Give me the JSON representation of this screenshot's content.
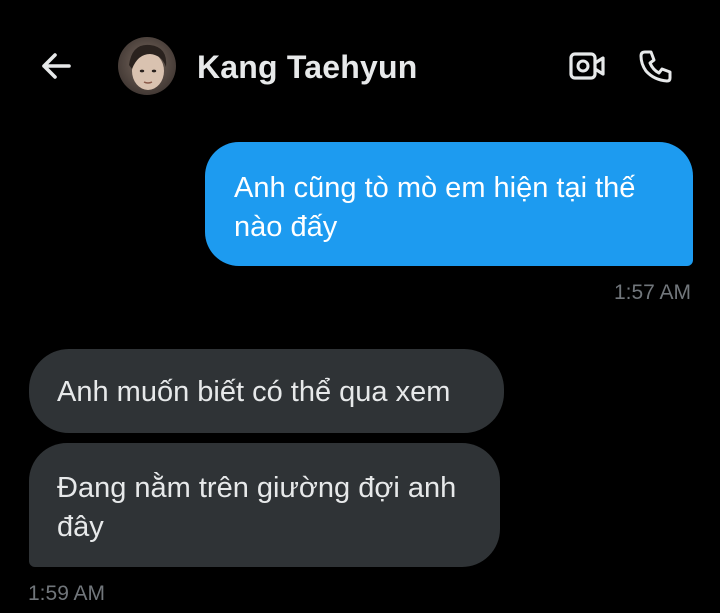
{
  "header": {
    "contact_name": "Kang Taehyun",
    "back_icon": "arrow-left-icon",
    "video_icon": "video-camera-icon",
    "call_icon": "phone-icon"
  },
  "messages": [
    {
      "direction": "outgoing",
      "text": "Anh cũng tò mò em hiện tại thế nào đấy"
    },
    {
      "direction": "incoming",
      "text": "Anh muốn biết có thể qua xem"
    },
    {
      "direction": "incoming",
      "text": "Đang nằm trên giường đợi anh đây"
    }
  ],
  "timestamps": {
    "outgoing": "1:57 AM",
    "incoming": "1:59 AM"
  },
  "colors": {
    "background": "#000000",
    "outgoing_bubble": "#1d9bf0",
    "incoming_bubble": "#2f3336",
    "text_primary": "#e7e9ea",
    "text_secondary": "#71767b"
  }
}
